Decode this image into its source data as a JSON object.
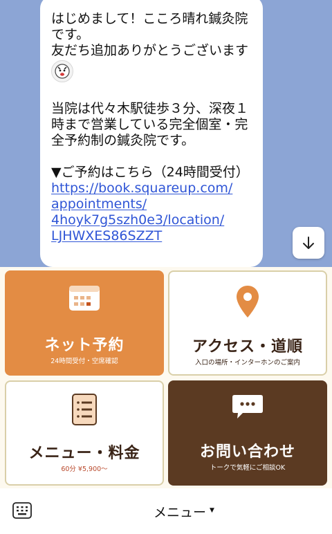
{
  "chat": {
    "message": {
      "line1": "はじめまして！こころ晴れ鍼灸院",
      "line2": "です。",
      "line3": "友だち追加ありがとうございます",
      "emoji_icon": "sticker-face-icon",
      "line4": "当院は代々木駅徒歩３分、深夜１",
      "line5": "時まで営業している完全個室・完",
      "line6": "全予約制の鍼灸院です。",
      "line7": "▼ご予約はこちら（24時間受付）",
      "link_lines": [
        "https://book.squareup.com/",
        "appointments/",
        "4hoyk7g5szh0e3/location/",
        "LJHWXES86SZZT"
      ]
    },
    "scroll_button_icon": "arrow-down-icon"
  },
  "rich_menu": {
    "tiles": [
      {
        "title": "ネット予約",
        "subtitle": "24時間受付・空席確認",
        "icon": "calendar-icon"
      },
      {
        "title": "アクセス・道順",
        "subtitle": "入口の場所・インターホンのご案内",
        "icon": "map-pin-icon"
      },
      {
        "title": "メニュー・料金",
        "subtitle": "60分 ¥5,900〜",
        "icon": "menu-list-icon"
      },
      {
        "title": "お問い合わせ",
        "subtitle": "トークで気軽にご相談OK",
        "icon": "chat-bubble-icon"
      }
    ],
    "colors": {
      "orange": "#e38c44",
      "brown": "#5b3a22",
      "cream": "#fdf9ef",
      "border": "#d9cfa8"
    }
  },
  "bottom_bar": {
    "keyboard_icon": "keyboard-icon",
    "label": "メニュー",
    "caret": "▼"
  }
}
